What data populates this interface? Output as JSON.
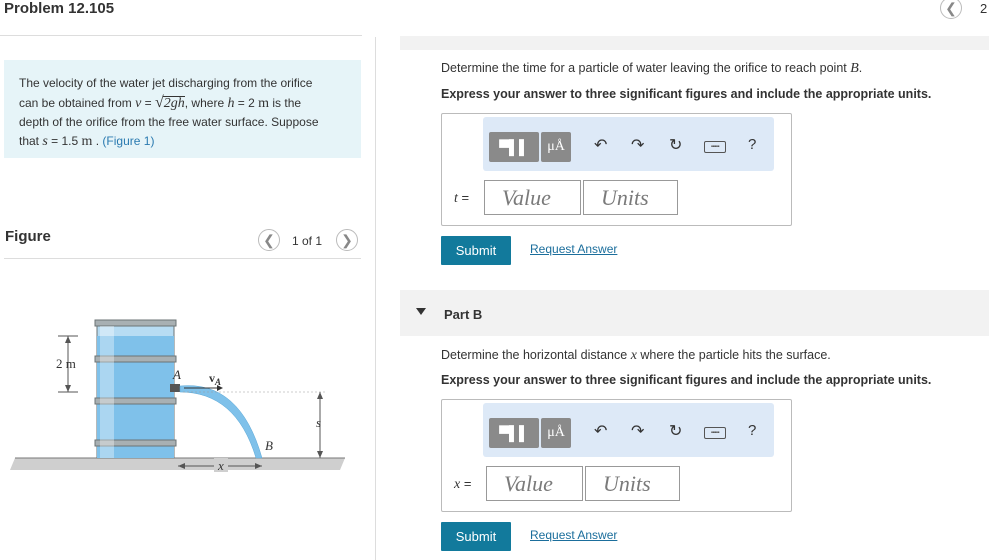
{
  "header": {
    "title": "Problem 12.105",
    "page_number": "2"
  },
  "intro": {
    "line1": "The velocity of the water jet discharging from the orifice",
    "line2_pre": "can be obtained from ",
    "line2_v": "v",
    "line2_eq": " = ",
    "line2_sqrt": "2gh",
    "line2_mid": ", where ",
    "line2_h": "h",
    "line2_val": " = 2 ",
    "line2_unit": "m",
    "line2_post": " is the",
    "line3": "depth of the orifice from the free water surface. Suppose",
    "line4_pre": "that ",
    "line4_s": "s",
    "line4_val": " = 1.5  ",
    "line4_unit": "m",
    "line4_post": " . ",
    "line4_link": "(Figure 1)"
  },
  "figure": {
    "label": "Figure",
    "count": "1 of 1",
    "dim_left": "2 m",
    "label_A": "A",
    "label_vA": "v",
    "label_vA_sub": "A",
    "label_B": "B",
    "label_s": "s",
    "label_x": "x",
    "colors": {
      "water": "#7fc1ea",
      "water_light": "#b7dcf3",
      "drum": "#9aa3a6",
      "ground": "#bfbfbf"
    }
  },
  "partA": {
    "question_pre": "Determine the time for a particle of water leaving the orifice to reach point ",
    "question_var": "B",
    "question_post": ".",
    "instruction": "Express your answer to three significant figures and include the appropriate units.",
    "var_label": "t",
    "var_eq": " =",
    "value_placeholder": "Value",
    "units_placeholder": "Units",
    "submit": "Submit",
    "request": "Request Answer"
  },
  "partB": {
    "label": "Part B",
    "question_pre": "Determine the horizontal distance ",
    "question_var": "x",
    "question_post": " where the particle hits the surface.",
    "instruction": "Express your answer to three significant figures and include the appropriate units.",
    "var_label": "x",
    "var_eq": " =",
    "value_placeholder": "Value",
    "units_placeholder": "Units",
    "submit": "Submit",
    "request": "Request Answer"
  },
  "toolbar": {
    "mu_label": "μÅ",
    "help": "?",
    "kbd": "▪▪▪▪▪",
    "icons": [
      "templates-icon",
      "units-icon",
      "undo-icon",
      "redo-icon",
      "reset-icon",
      "keyboard-icon",
      "help-icon"
    ]
  },
  "icons": {
    "prev": "❮",
    "next": "❯",
    "undo": "↶",
    "redo": "↷",
    "reset": "↻"
  },
  "accent": "#127a9c"
}
